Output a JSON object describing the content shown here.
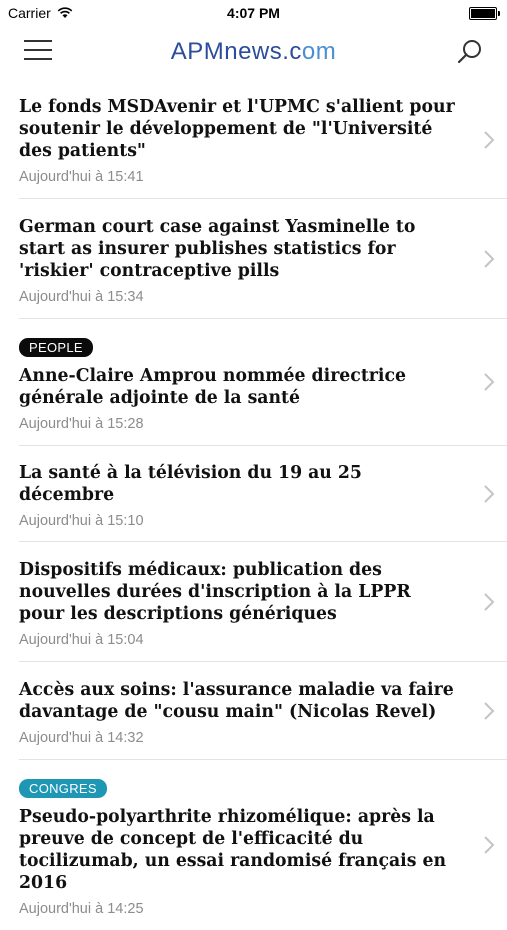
{
  "status_bar": {
    "carrier": "Carrier",
    "time": "4:07 PM"
  },
  "header": {
    "logo_main": "APMnews.c",
    "logo_accent": "om",
    "menu_icon": "hamburger-menu-icon",
    "search_icon": "search-icon"
  },
  "colors": {
    "people_tag": "#0b0b0b",
    "congres_tag": "#1e97b5",
    "logo": "#2c4d9c"
  },
  "news": [
    {
      "tag": "",
      "headline": "Le fonds MSDAvenir et l'UPMC s'allient pour soutenir le développement de \"l'Université des patients\"",
      "time": "Aujourd'hui à 15:41"
    },
    {
      "tag": "",
      "headline": "German court case against Yasminelle to start as insurer publishes statistics for 'riskier' contraceptive pills",
      "time": "Aujourd'hui à 15:34"
    },
    {
      "tag": "PEOPLE",
      "headline": "Anne-Claire Amprou nommée directrice générale adjointe de la santé",
      "time": "Aujourd'hui à 15:28"
    },
    {
      "tag": "",
      "headline": "La santé à la télévision du 19 au 25 décembre",
      "time": "Aujourd'hui à 15:10"
    },
    {
      "tag": "",
      "headline": "Dispositifs médicaux: publication des nouvelles durées d'inscription à la LPPR pour les descriptions génériques",
      "time": "Aujourd'hui à 15:04"
    },
    {
      "tag": "",
      "headline": "Accès aux soins: l'assurance maladie va faire davantage de \"cousu main\" (Nicolas Revel)",
      "time": "Aujourd'hui à 14:32"
    },
    {
      "tag": "CONGRES",
      "headline": "Pseudo-polyarthrite rhizomélique: après la preuve de concept de l'efficacité du tocilizumab, un essai randomisé français en 2016",
      "time": "Aujourd'hui à 14:25"
    }
  ]
}
